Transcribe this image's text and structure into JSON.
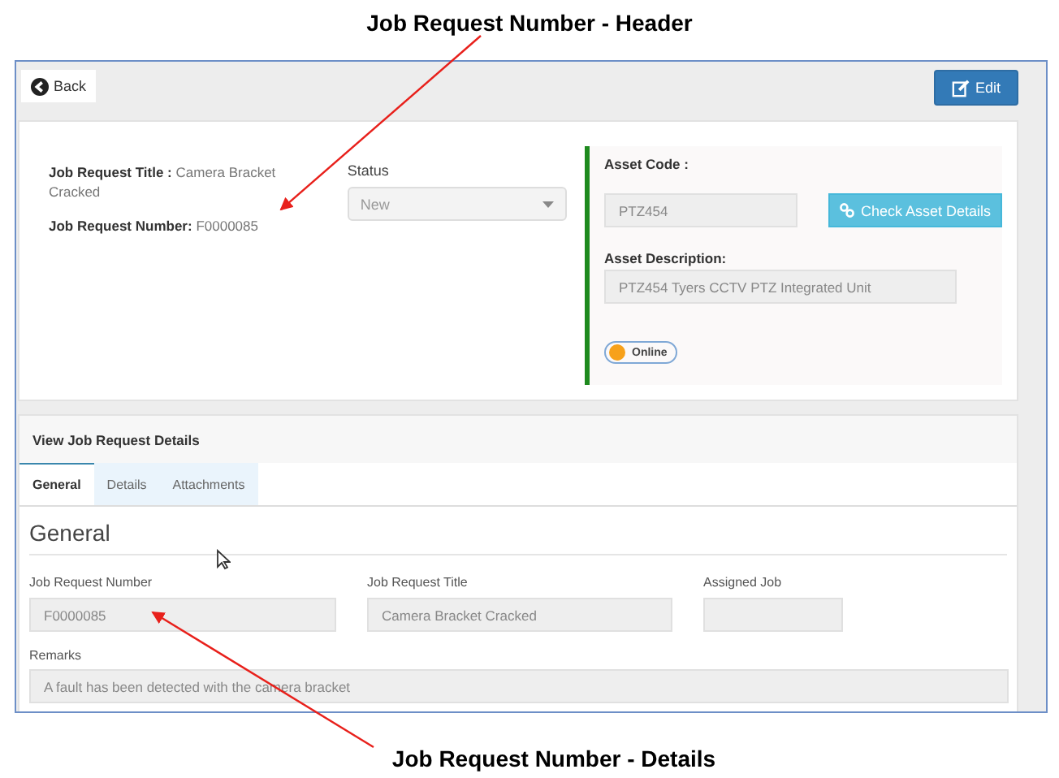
{
  "annotations": [
    {
      "text": "Job Request Number - Header",
      "kind": "top"
    },
    {
      "text": "Job Request Number - Details",
      "kind": "bottom"
    }
  ],
  "toolbar": {
    "back": "Back",
    "edit": "Edit"
  },
  "header": {
    "title_label": "Job Request Title :",
    "title_value": "Camera Bracket Cracked",
    "number_label": "Job Request Number:",
    "number_value": "F0000085",
    "status_label": "Status",
    "status_value": "New"
  },
  "asset": {
    "code_label": "Asset Code :",
    "code_value": "PTZ454",
    "check_button": "Check Asset Details",
    "description_label": "Asset Description:",
    "description_value": "PTZ454 Tyers CCTV PTZ Integrated Unit",
    "status": {
      "label": "Online",
      "color": "#f7a11a"
    }
  },
  "details": {
    "title": "View Job Request Details",
    "tabs": [
      {
        "label": "General",
        "selected": true
      },
      {
        "label": "Details",
        "selected": false
      },
      {
        "label": "Attachments",
        "selected": false
      }
    ],
    "section": "General",
    "fields": [
      {
        "label": "Job Request Number",
        "value": "F0000085"
      },
      {
        "label": "Job Request Title",
        "value": "Camera Bracket Cracked"
      },
      {
        "label": "Assigned Job"
      }
    ],
    "remarks": {
      "label": "Remarks",
      "value": "A fault has been detected with the camera bracket"
    }
  }
}
